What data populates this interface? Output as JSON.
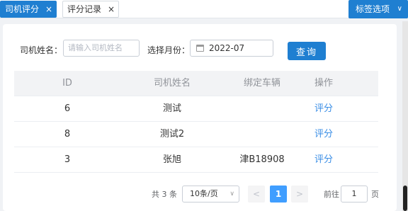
{
  "tabs": {
    "active_label": "司机评分",
    "inactive_label": "评分记录",
    "close_glyph": "×",
    "options_label": "标签选项",
    "options_chevron": "∨"
  },
  "filters": {
    "driver_label": "司机姓名：",
    "driver_placeholder": "请输入司机姓名",
    "month_label": "选择月份：",
    "month_value": "2022-07",
    "query_label": "查询"
  },
  "table": {
    "headers": [
      "ID",
      "司机姓名",
      "绑定车辆",
      "操作"
    ],
    "rows": [
      {
        "id": "6",
        "name": "测试",
        "car": "",
        "op": "评分"
      },
      {
        "id": "8",
        "name": "测试2",
        "car": "",
        "op": "评分"
      },
      {
        "id": "3",
        "name": "张旭",
        "car": "津B18908",
        "op": "评分"
      }
    ]
  },
  "pagination": {
    "total": "共 3 条",
    "page_size": "10条/页",
    "prev": "<",
    "current_page": "1",
    "next": ">",
    "goto_label": "前往",
    "goto_value": "1",
    "goto_suffix": "页"
  },
  "colors": {
    "primary": "#1f7fd1",
    "link": "#3a8ee6",
    "page_active": "#409eff"
  }
}
